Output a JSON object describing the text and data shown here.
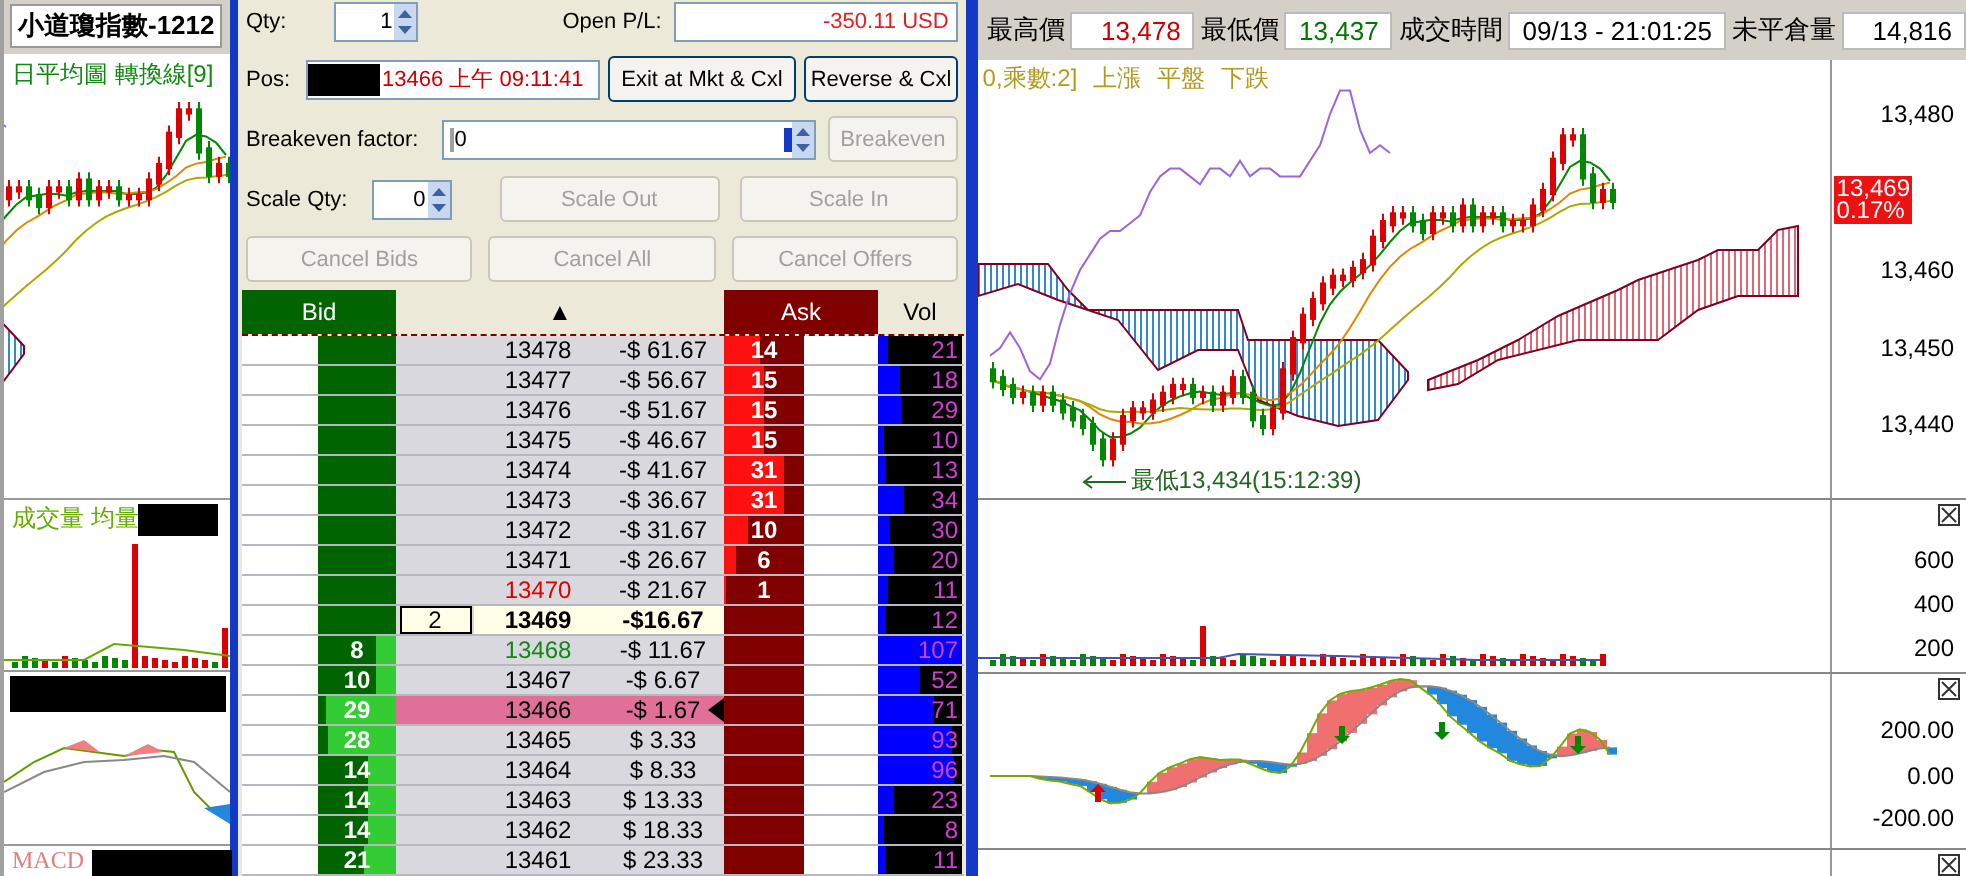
{
  "left_chart": {
    "symbol": "小道瓊指數-1212",
    "indicator_label": "日平均圖 轉換線[9]",
    "volume_label": "成交量 均量",
    "macd_label": "MACD"
  },
  "order_panel": {
    "qty": {
      "label": "Qty:",
      "value": "1"
    },
    "open_pl": {
      "label": "Open P/L:",
      "value": "-350.11 USD"
    },
    "pos": {
      "label": "Pos:",
      "value": "13466 上午 09:11:41"
    },
    "position_buttons": [
      {
        "label": "Exit at Mkt & Cxl",
        "disabled": false
      },
      {
        "label": "Reverse & Cxl",
        "disabled": false
      }
    ],
    "breakeven": {
      "label": "Breakeven factor:",
      "value": "0",
      "button": {
        "label": "Breakeven",
        "disabled": true
      }
    },
    "scale": {
      "label": "Scale Qty:",
      "value": "0",
      "buttons": [
        {
          "label": "Scale Out",
          "disabled": true
        },
        {
          "label": "Scale In",
          "disabled": true
        }
      ]
    },
    "cancel_buttons": [
      {
        "label": "Cancel Bids",
        "disabled": true
      },
      {
        "label": "Cancel All",
        "disabled": true
      },
      {
        "label": "Cancel Offers",
        "disabled": true
      }
    ]
  },
  "ladder": {
    "headers": {
      "bid": "Bid",
      "price": "▲",
      "ask": "Ask",
      "vol": "Vol"
    },
    "rows": [
      {
        "kind": "normal",
        "price": "13478",
        "pnl": "-$ 61.67",
        "ask": {
          "qty": "14",
          "level": 0.46
        },
        "vol": {
          "value": "21",
          "level": 0.12
        },
        "position": false
      },
      {
        "kind": "normal",
        "price": "13477",
        "pnl": "-$ 56.67",
        "ask": {
          "qty": "15",
          "level": 0.5
        },
        "vol": {
          "value": "18",
          "level": 0.25
        },
        "position": false
      },
      {
        "kind": "normal",
        "price": "13476",
        "pnl": "-$ 51.67",
        "ask": {
          "qty": "15",
          "level": 0.5
        },
        "vol": {
          "value": "29",
          "level": 0.28
        },
        "position": false
      },
      {
        "kind": "normal",
        "price": "13475",
        "pnl": "-$ 46.67",
        "ask": {
          "qty": "15",
          "level": 0.5
        },
        "vol": {
          "value": "10",
          "level": 0.08
        },
        "position": false
      },
      {
        "kind": "normal",
        "price": "13474",
        "pnl": "-$ 41.67",
        "ask": {
          "qty": "31",
          "level": 0.76
        },
        "vol": {
          "value": "13",
          "level": 0.1
        },
        "position": false
      },
      {
        "kind": "normal",
        "price": "13473",
        "pnl": "-$ 36.67",
        "ask": {
          "qty": "31",
          "level": 0.76
        },
        "vol": {
          "value": "34",
          "level": 0.3
        },
        "position": false
      },
      {
        "kind": "normal",
        "price": "13472",
        "pnl": "-$ 31.67",
        "ask": {
          "qty": "10",
          "level": 0.3
        },
        "vol": {
          "value": "30",
          "level": 0.15
        },
        "position": false
      },
      {
        "kind": "normal",
        "price": "13471",
        "pnl": "-$ 26.67",
        "ask": {
          "qty": "6",
          "level": 0.14
        },
        "vol": {
          "value": "20",
          "level": 0.18
        },
        "position": false
      },
      {
        "kind": "best_ask",
        "price": "13470",
        "pnl": "-$ 21.67",
        "ask": {
          "qty": "1",
          "level": 0.02
        },
        "vol": {
          "value": "11",
          "level": 0.12
        },
        "position": false
      },
      {
        "kind": "last",
        "price": "13469",
        "pnl": "-$16.67",
        "order": "2",
        "vol": {
          "value": "12",
          "level": 0.1
        },
        "position": false
      },
      {
        "kind": "best_bid",
        "price": "13468",
        "pnl": "-$ 11.67",
        "bid": {
          "qty": "8",
          "level": 0.26
        },
        "vol": {
          "value": "107",
          "level": 1.0
        },
        "position": false
      },
      {
        "kind": "normal",
        "price": "13467",
        "pnl": "-$ 6.67",
        "bid": {
          "qty": "10",
          "level": 0.25
        },
        "vol": {
          "value": "52",
          "level": 0.5
        },
        "position": false
      },
      {
        "kind": "normal",
        "price": "13466",
        "pnl": "-$ 1.67",
        "bid": {
          "qty": "29",
          "level": 0.91
        },
        "vol": {
          "value": "71",
          "level": 0.67
        },
        "position": true
      },
      {
        "kind": "normal",
        "price": "13465",
        "pnl": "$ 3.33",
        "bid": {
          "qty": "28",
          "level": 0.87
        },
        "vol": {
          "value": "93",
          "level": 0.88
        },
        "position": false
      },
      {
        "kind": "normal",
        "price": "13464",
        "pnl": "$ 8.33",
        "bid": {
          "qty": "14",
          "level": 0.35
        },
        "vol": {
          "value": "96",
          "level": 0.9
        },
        "position": false
      },
      {
        "kind": "normal",
        "price": "13463",
        "pnl": "$ 13.33",
        "bid": {
          "qty": "14",
          "level": 0.35
        },
        "vol": {
          "value": "23",
          "level": 0.2
        },
        "position": false
      },
      {
        "kind": "normal",
        "price": "13462",
        "pnl": "$ 18.33",
        "bid": {
          "qty": "14",
          "level": 0.35
        },
        "vol": {
          "value": "8",
          "level": 0.07
        },
        "position": false
      },
      {
        "kind": "normal",
        "price": "13461",
        "pnl": "$ 23.33",
        "bid": {
          "qty": "21",
          "level": 0.4
        },
        "vol": {
          "value": "11",
          "level": 0.1
        },
        "position": false
      }
    ]
  },
  "quote_bar": [
    {
      "label": "最高價",
      "value": "13,478",
      "color": "#cc0000"
    },
    {
      "label": "最低價",
      "value": "13,437",
      "color": "#007700"
    },
    {
      "label": "成交時間",
      "value": "09/13 - 21:01:25",
      "color": "#000000"
    },
    {
      "label": "未平倉量",
      "value": "14,816",
      "color": "#000000"
    }
  ],
  "price_chart": {
    "legend": [
      "0,乘數:2]",
      "上漲",
      "平盤",
      "下跌"
    ],
    "y_labels": [
      "13,480",
      "13,460",
      "13,450",
      "13,440"
    ],
    "last_price": "13,469",
    "change": "0.17%",
    "low_annotation": "最低13,434(15:12:39)"
  },
  "volume_pane": {
    "y_labels": [
      "600",
      "400",
      "200"
    ]
  },
  "macd_pane": {
    "y_labels": [
      "200.00",
      "0.00",
      "-200.00"
    ]
  }
}
